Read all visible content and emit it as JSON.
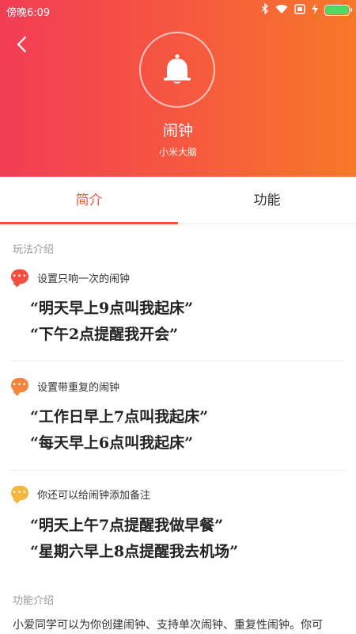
{
  "status_bar": {
    "time": "傍晚6:09"
  },
  "header": {
    "title": "闹钟",
    "subtitle": "小米大脑",
    "icon": "bell-icon",
    "gradient_start": "#f33c55",
    "gradient_end": "#f7782a"
  },
  "tabs": [
    {
      "label": "简介",
      "active": true
    },
    {
      "label": "功能",
      "active": false
    }
  ],
  "usage": {
    "section_title": "玩法介绍",
    "items": [
      {
        "title": "设置只响一次的闹钟",
        "bubble_color": "#f2503f",
        "examples": [
          "“明天早上9点叫我起床”",
          "“下午2点提醒我开会”"
        ]
      },
      {
        "title": "设置带重复的闹钟",
        "bubble_color": "#f5843c",
        "examples": [
          "“工作日早上7点叫我起床”",
          "“每天早上6点叫我起床”"
        ]
      },
      {
        "title": "你还可以给闹钟添加备注",
        "bubble_color": "#f5b640",
        "examples": [
          "“明天上午7点提醒我做早餐”",
          "“星期六早上8点提醒我去机场”"
        ]
      }
    ]
  },
  "feature": {
    "section_title": "功能介绍",
    "description": "小爱同学可以为你创建闹钟、支持单次闹钟、重复性闹钟。你可"
  },
  "colors": {
    "accent": "#f4553f"
  }
}
